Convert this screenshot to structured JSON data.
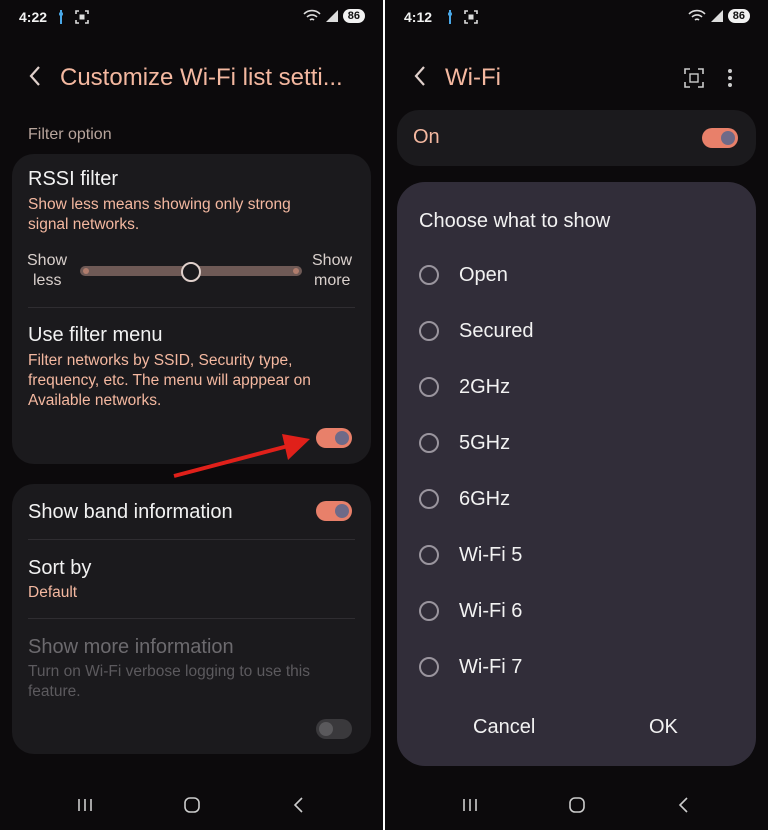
{
  "left_screen": {
    "status": {
      "time": "4:22",
      "battery": "86"
    },
    "header": {
      "title": "Customize Wi-Fi list setti..."
    },
    "section_label": "Filter option",
    "rssi": {
      "title": "RSSI filter",
      "subtitle_line1": "Show less means showing only strong",
      "subtitle_line2": "signal networks.",
      "min_label_line1": "Show",
      "min_label_line2": "less",
      "max_label_line1": "Show",
      "max_label_line2": "more",
      "level": 0.5
    },
    "filter_menu": {
      "title": "Use filter menu",
      "line1": "Filter networks by SSID, Security type,",
      "line2": "frequency, etc. The menu will apppear on",
      "line3": "Available networks.",
      "enabled": true
    },
    "band_info": {
      "title": "Show band information",
      "enabled": true
    },
    "sort_by": {
      "title": "Sort by",
      "value": "Default"
    },
    "more_info": {
      "title": "Show more information",
      "line1": "Turn on Wi-Fi verbose logging to use this",
      "line2": "feature.",
      "enabled": false
    },
    "colors": {
      "accent": "#f4b8a0",
      "toggle_on": "#e8806a",
      "arrow": "#e0201a",
      "card": "#1b1a1d"
    }
  },
  "right_screen": {
    "status": {
      "time": "4:12",
      "battery": "86"
    },
    "header": {
      "title": "Wi-Fi"
    },
    "master_switch": {
      "label": "On",
      "enabled": true
    },
    "dialog": {
      "title": "Choose what to show",
      "options": [
        "Open",
        "Secured",
        "2GHz",
        "5GHz",
        "6GHz",
        "Wi-Fi 5",
        "Wi-Fi 6",
        "Wi-Fi 7"
      ],
      "cancel_label": "Cancel",
      "ok_label": "OK"
    },
    "colors": {
      "dialog": "#312d39"
    }
  },
  "navbar": {
    "icons": [
      "recents-icon",
      "home-icon",
      "back-icon"
    ]
  }
}
